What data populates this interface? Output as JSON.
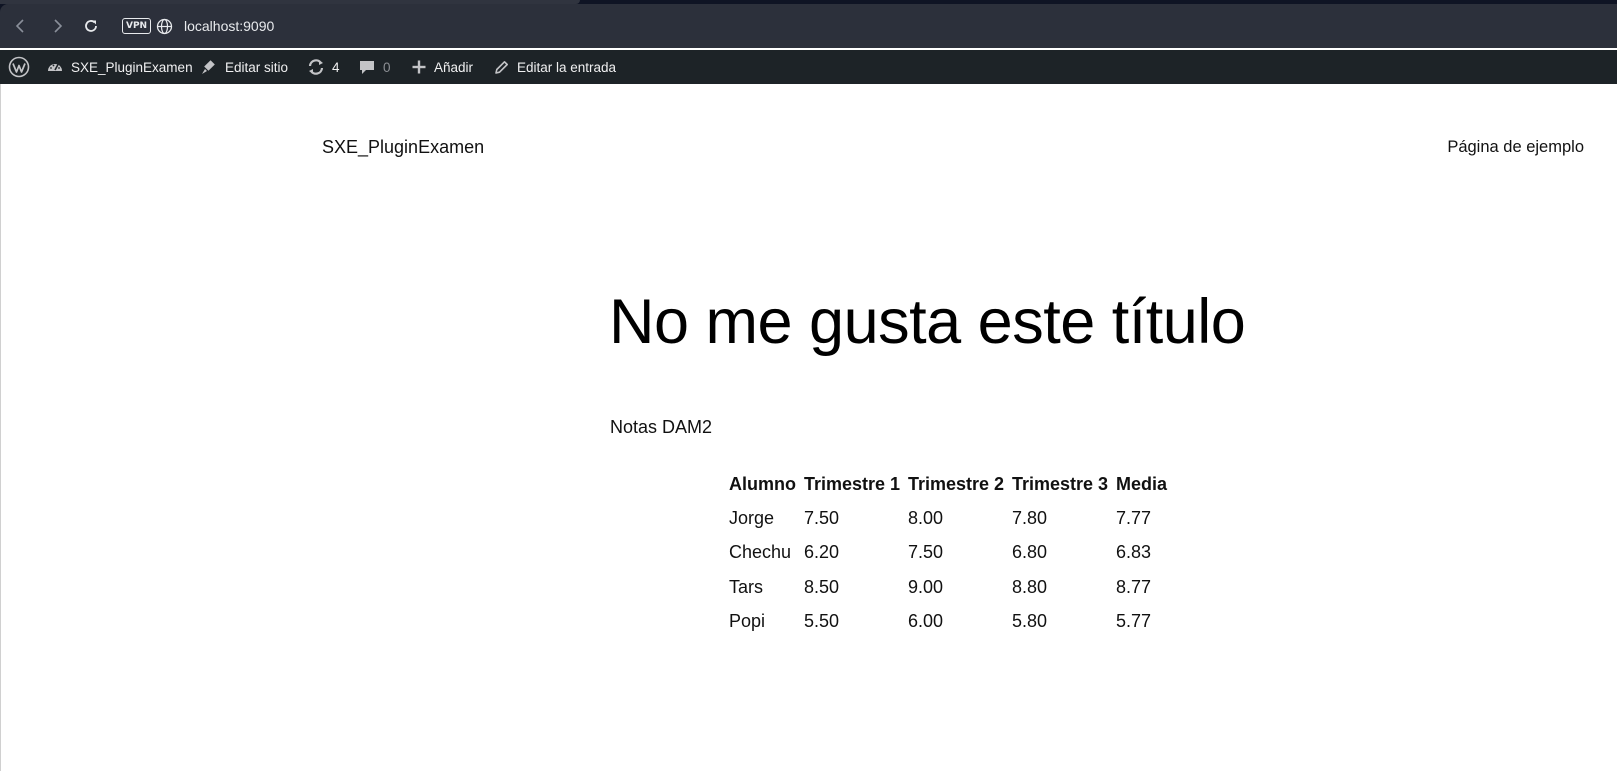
{
  "browser": {
    "url": "localhost:9090",
    "vpn_label": "VPN"
  },
  "adminbar": {
    "site_name": "SXE_PluginExamen",
    "edit_site": "Editar sitio",
    "updates_count": "4",
    "comments_count": "0",
    "add_new": "Añadir",
    "edit_post": "Editar la entrada"
  },
  "site": {
    "title": "SXE_PluginExamen",
    "nav_link": "Página de ejemplo"
  },
  "post": {
    "title": "No me gusta este título",
    "notes_heading": "Notas DAM2"
  },
  "table": {
    "headers": [
      "Alumno",
      "Trimestre 1",
      "Trimestre 2",
      "Trimestre 3",
      "Media"
    ],
    "rows": [
      [
        "Jorge",
        "7.50",
        "8.00",
        "7.80",
        "7.77"
      ],
      [
        "Chechu",
        "6.20",
        "7.50",
        "6.80",
        "6.83"
      ],
      [
        "Tars",
        "8.50",
        "9.00",
        "8.80",
        "8.77"
      ],
      [
        "Popi",
        "5.50",
        "6.00",
        "5.80",
        "5.77"
      ]
    ]
  },
  "colors": {
    "browser_frame": "#0f1424",
    "address_bar": "#2c303b",
    "adminbar": "#1d2327"
  }
}
